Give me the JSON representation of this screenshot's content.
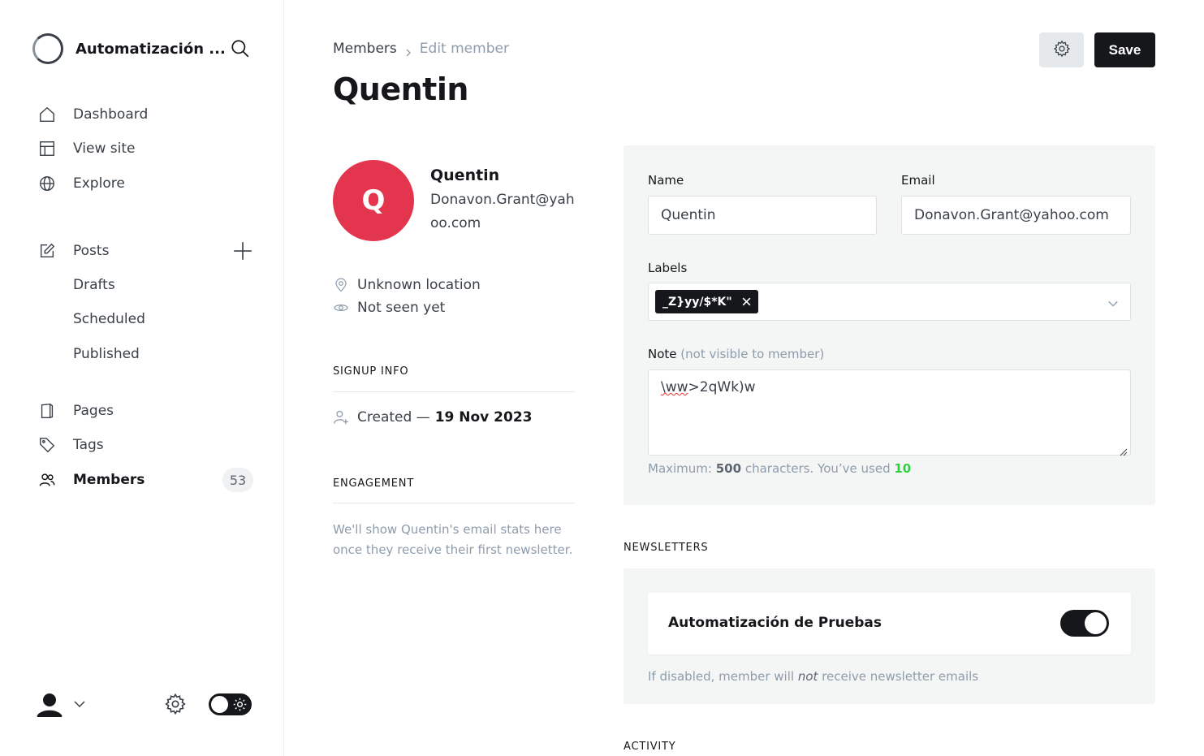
{
  "sidebar": {
    "site_name": "Automatización ...",
    "nav": {
      "dashboard": "Dashboard",
      "view_site": "View site",
      "explore": "Explore",
      "posts": "Posts",
      "drafts": "Drafts",
      "scheduled": "Scheduled",
      "published": "Published",
      "pages": "Pages",
      "tags": "Tags",
      "members": "Members",
      "members_count": "53"
    }
  },
  "header": {
    "breadcrumb_parent": "Members",
    "breadcrumb_current": "Edit member",
    "title": "Quentin",
    "save_label": "Save"
  },
  "member": {
    "initial": "Q",
    "name": "Quentin",
    "email": "Donavon.Grant@yahoo.com",
    "location": "Unknown location",
    "last_seen": "Not seen yet",
    "signup_heading": "SIGNUP INFO",
    "created_prefix": "Created —",
    "created_date": "19 Nov 2023",
    "engagement_heading": "ENGAGEMENT",
    "engagement_text": "We'll show Quentin's email stats here once they receive their first newsletter."
  },
  "form": {
    "name_label": "Name",
    "name_value": "Quentin",
    "email_label": "Email",
    "email_value": "Donavon.Grant@yahoo.com",
    "labels_label": "Labels",
    "label_chip": "_Z}yy/$*K\"",
    "note_label": "Note",
    "note_label_muted": "(not visible to member)",
    "note_value_prefix": "\\ww",
    "note_value_rest": ">2qWk)w",
    "note_hint_prefix": "Maximum:",
    "note_max": "500",
    "note_hint_mid": "characters. You’ve used",
    "note_used": "10"
  },
  "newsletters": {
    "heading": "NEWSLETTERS",
    "items": [
      {
        "name": "Automatización de Pruebas",
        "subscribed": true
      }
    ],
    "hint_prefix": "If disabled, member will",
    "hint_em": "not",
    "hint_suffix": "receive newsletter emails"
  },
  "activity_heading": "ACTIVITY",
  "colors": {
    "accent": "#15171a",
    "avatar_bg": "#e4354e",
    "used_count": "#30cf43",
    "muted_text": "#8e9cac"
  }
}
